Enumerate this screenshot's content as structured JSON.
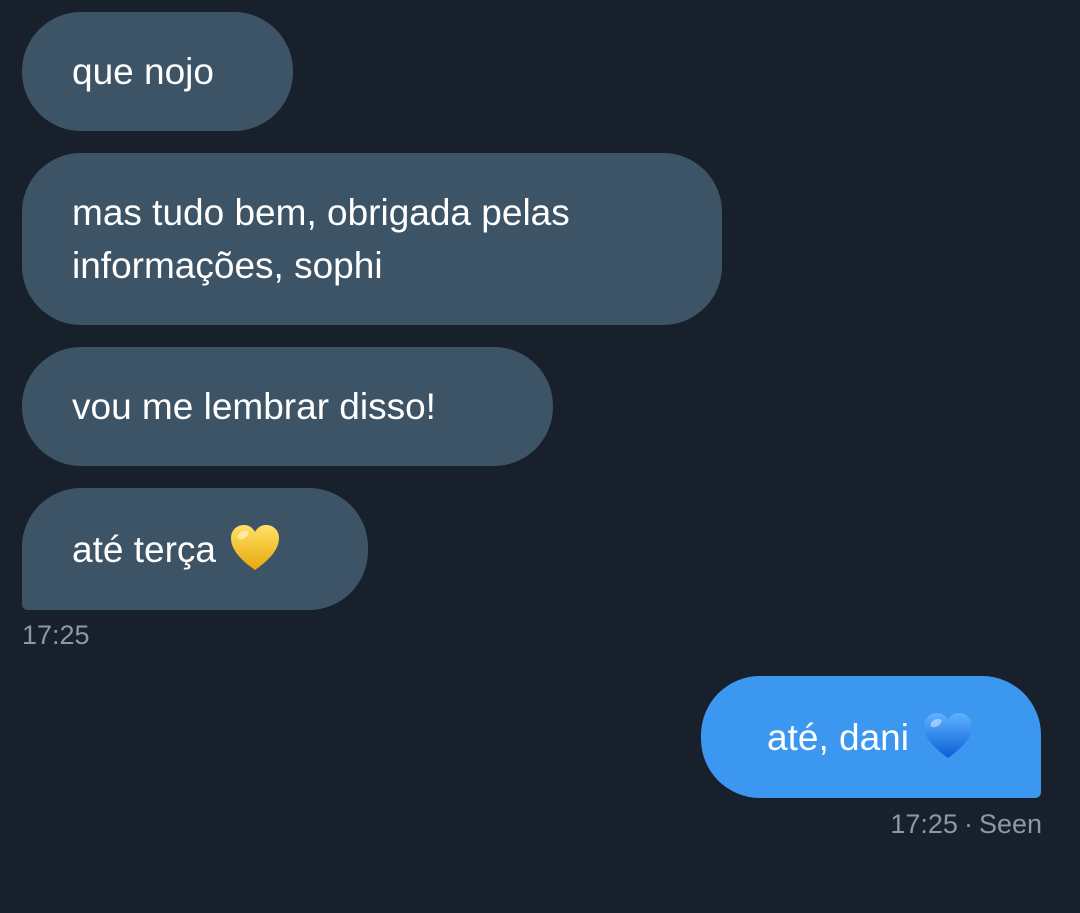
{
  "messages": [
    {
      "text": "que nojo",
      "direction": "received"
    },
    {
      "text": "mas tudo bem, obrigada pelas informações, sophi",
      "direction": "received"
    },
    {
      "text": "vou me lembrar disso!",
      "direction": "received"
    },
    {
      "text": "até terça",
      "direction": "received",
      "emoji": "yellow-heart-icon"
    },
    {
      "text": "até, dani",
      "direction": "sent",
      "emoji": "blue-heart-icon"
    }
  ],
  "received_time": "17:25",
  "sent_status": {
    "time": "17:25",
    "separator": "·",
    "label": "Seen"
  },
  "colors": {
    "background": "#18202b",
    "received_bubble": "#3d5466",
    "sent_bubble": "#3b97ef",
    "meta_text": "#8b98a5",
    "yellow_heart": "#f5c518",
    "blue_heart": "#1f7fe8"
  }
}
